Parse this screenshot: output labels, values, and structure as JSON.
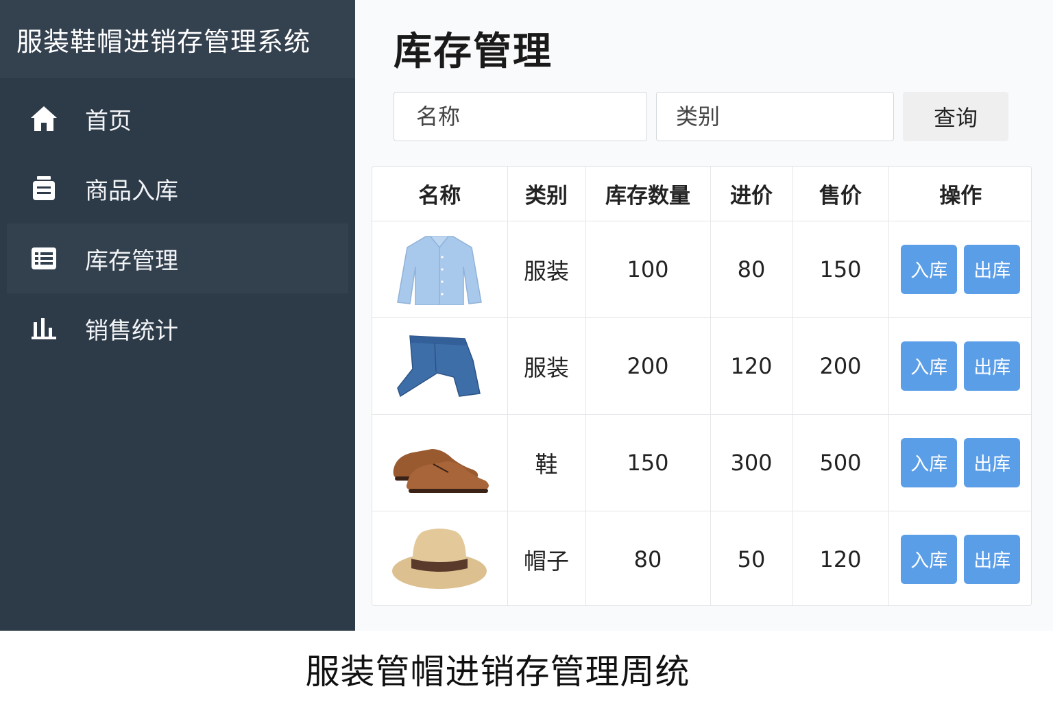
{
  "app": {
    "title": "服装鞋帽进销存管理系统"
  },
  "sidebar": {
    "items": [
      {
        "label": "首页",
        "icon": "home-icon"
      },
      {
        "label": "商品入库",
        "icon": "inbox-icon"
      },
      {
        "label": "库存管理",
        "icon": "list-icon",
        "active": true
      },
      {
        "label": "销售统计",
        "icon": "bar-chart-icon"
      }
    ]
  },
  "main": {
    "title": "库存管理",
    "search": {
      "name_placeholder": "名称",
      "category_placeholder": "类别",
      "query_label": "查询"
    },
    "table": {
      "columns": [
        "名称",
        "类别",
        "库存数量",
        "进价",
        "售价",
        "操作"
      ],
      "rows": [
        {
          "image": "shirt-image",
          "category": "服装",
          "stock": "100",
          "cost": "80",
          "price": "150"
        },
        {
          "image": "jeans-image",
          "category": "服装",
          "stock": "200",
          "cost": "120",
          "price": "200"
        },
        {
          "image": "shoes-image",
          "category": "鞋",
          "stock": "150",
          "cost": "300",
          "price": "500"
        },
        {
          "image": "hat-image",
          "category": "帽子",
          "stock": "80",
          "cost": "50",
          "price": "120"
        }
      ],
      "actions": {
        "in_label": "入库",
        "out_label": "出库"
      }
    }
  },
  "caption": "服装管帽进销存管理周统",
  "colors": {
    "sidebar": "#2d3a48",
    "accent": "#5b9ee8"
  }
}
